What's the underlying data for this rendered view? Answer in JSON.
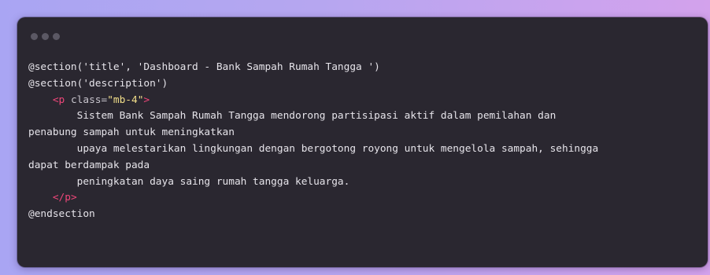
{
  "window": {
    "controls": [
      "window-dot",
      "window-dot",
      "window-dot"
    ]
  },
  "code": {
    "section_title": "@section('title', 'Dashboard - Bank Sampah Rumah Tangga ')",
    "section_description": "@section('description')",
    "p_open_indent": "    ",
    "p_open_tag": "<p",
    "p_attr_name": " class=",
    "p_attr_value": "\"mb-4\"",
    "p_open_close": ">",
    "text_line_1": "        Sistem Bank Sampah Rumah Tangga mendorong partisipasi aktif dalam pemilahan dan",
    "text_line_2": "penabung sampah untuk meningkatkan",
    "text_line_3": "        upaya melestarikan lingkungan dengan bergotong royong untuk mengelola sampah, sehingga",
    "text_line_4": "dapat berdampak pada",
    "text_line_5": "        peningkatan daya saing rumah tangga keluarga.",
    "p_close_indent": "    ",
    "p_close_tag": "</p>",
    "endsection": "@endsection"
  },
  "colors": {
    "background_start": "#a9a5f3",
    "background_end": "#d3a2ec",
    "window": "#2a2730",
    "tag": "#f0477a",
    "string": "#f3df8a",
    "text": "#e6e4ea"
  }
}
